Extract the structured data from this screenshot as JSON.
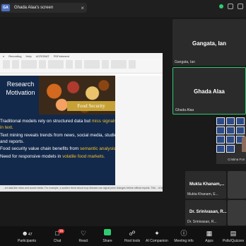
{
  "topbar": {
    "badge": "GA",
    "share_title": "Ghada Alaa's screen",
    "close_glyph": "×"
  },
  "colors": {
    "active_border": "#2ecc71",
    "slide_bg": "#13294b",
    "highlight": "#f2c230",
    "share_green": "#2ecc71",
    "alert_red": "#e23b3b"
  },
  "ppt": {
    "tabs": [
      "e",
      "Recording",
      "Help",
      "ACROBAT",
      "PDFelement"
    ],
    "slide_title": "Research Motivation",
    "image_caption": "Food Security",
    "bullets": [
      {
        "text": "Traditional models rely on structured data but ",
        "highlight": "miss signals in text.",
        "after": ""
      },
      {
        "text": "Text mining reveals trends from news, social media, studies and reports.",
        "highlight": "",
        "after": ""
      },
      {
        "text": "Food security value chain benefits from ",
        "highlight": "semantic analysis.",
        "after": ""
      },
      {
        "text": "Need for responsive models in ",
        "highlight": "volatile food markets.",
        "after": ""
      }
    ],
    "status_text": "...ed data like news and social media. For example, a sudden trend about crop disease can signal price changes before official reports. This ...nt signals, we need more smart scale methods."
  },
  "participants_tiles": [
    {
      "big_name": "Gangata, Ian",
      "small_name": "Gangata, Ian"
    },
    {
      "big_name": "Ghada Alaa",
      "small_name": "Ghada Alaa"
    }
  ],
  "gallery": {
    "label": "Cristina Fon"
  },
  "small_tiles": [
    {
      "big_name": "Mukta Khanam,...",
      "small_name": "Mukta Khanam, E..."
    },
    {
      "big_name": "Dr. Srinivasan, R...",
      "small_name": "Dr. Srinivasan, R..."
    }
  ],
  "toolbar": {
    "items": [
      {
        "label": "Participants",
        "icon": "participants-icon",
        "count": "47"
      },
      {
        "label": "Chat",
        "icon": "chat-icon",
        "badge": "15"
      },
      {
        "label": "React",
        "icon": "react-icon"
      },
      {
        "label": "Share",
        "icon": "share-icon"
      },
      {
        "label": "Host tools",
        "icon": "host-tools-icon"
      },
      {
        "label": "AI Companion",
        "icon": "ai-companion-icon"
      },
      {
        "label": "Meeting info",
        "icon": "info-icon"
      },
      {
        "label": "Apps",
        "icon": "apps-icon"
      },
      {
        "label": "Polls/Quizzes",
        "icon": "polls-icon"
      }
    ]
  }
}
